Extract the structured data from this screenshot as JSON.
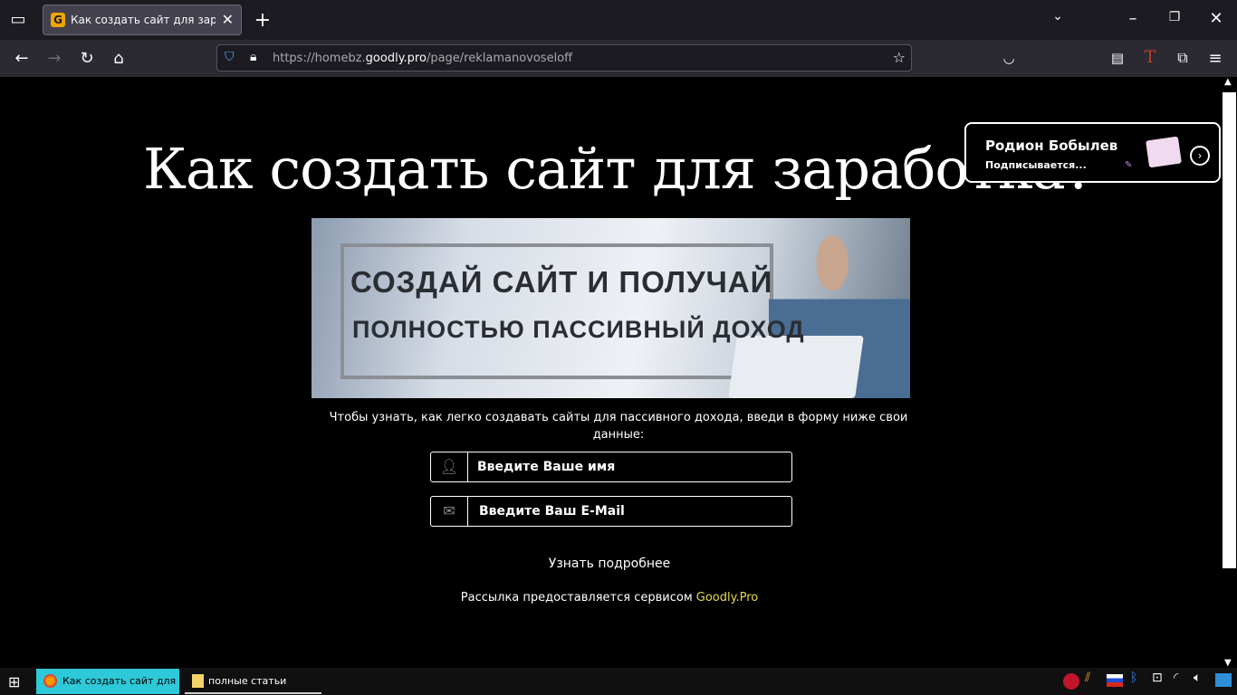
{
  "browser": {
    "tab": {
      "title": "Как создать сайт для заработка",
      "favicon": "G"
    },
    "url": {
      "prefix": "https://homebz.",
      "domain": "goodly.pro",
      "path": "/page/reklamanovoseloff"
    }
  },
  "page": {
    "heading": "Как создать сайт для заработка?",
    "banner": {
      "line1": "СОЗДАЙ САЙТ И ПОЛУЧАЙ",
      "line2": "ПОЛНОСТЬЮ ПАССИВНЫЙ ДОХОД"
    },
    "intro": "Чтобы узнать, как легко создавать сайты для пассивного дохода, введи в форму ниже свои данные:",
    "form": {
      "name_placeholder": "Введите Ваше имя",
      "email_placeholder": "Введите Ваш E-Mail",
      "submit_label": "Узнать подробнее"
    },
    "footer": {
      "text": "Рассылка предоставляется сервисом ",
      "link": "Goodly.Pro"
    }
  },
  "notification": {
    "name": "Родион Бобылев",
    "status": "Подписывается..."
  },
  "taskbar": {
    "items": [
      "Как создать сайт для...",
      "полные статьи"
    ]
  },
  "colors": {
    "accent_link": "#e8d84a",
    "taskbar_active": "#2ec9d8"
  }
}
